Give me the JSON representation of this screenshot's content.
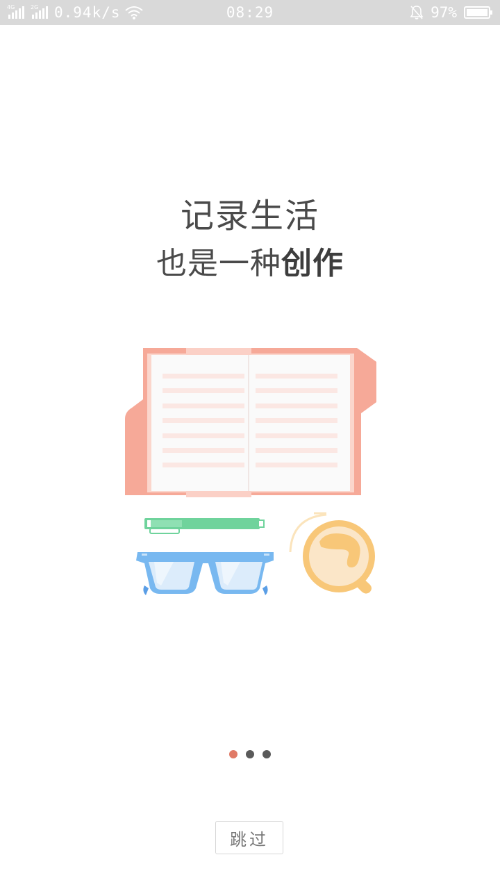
{
  "status_bar": {
    "net1": "4G",
    "net2": "2G",
    "speed": "0.94k/s",
    "time": "08:29",
    "battery_pct": "97%",
    "icons": [
      "signal-icon",
      "signal-icon",
      "wifi-icon",
      "bell-muted-icon",
      "battery-icon"
    ]
  },
  "headline": {
    "line1": "记录生活",
    "line2_prefix": "也是一种",
    "line2_bold": "创作"
  },
  "illustration": {
    "icons": [
      "open-book-icon",
      "pen-icon",
      "glasses-icon",
      "coffee-cup-icon"
    ],
    "colors": {
      "book": "#f6a998",
      "pen": "#6fd39c",
      "glasses": "#78b8f0",
      "coffee": "#f8c778"
    }
  },
  "pager": {
    "total": 3,
    "active_index": 0,
    "active_color": "#e07a66",
    "inactive_color": "#5a5a5a"
  },
  "skip_button": {
    "label": "跳过"
  }
}
